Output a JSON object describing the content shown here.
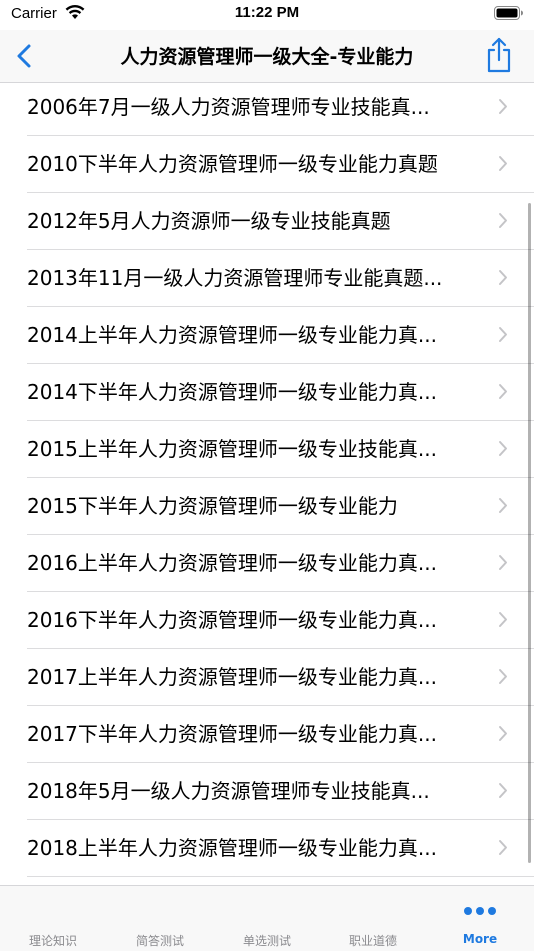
{
  "status_bar": {
    "carrier": "Carrier",
    "time": "11:22 PM",
    "wifi_icon": "wifi-icon",
    "battery_icon": "battery-icon"
  },
  "nav_bar": {
    "title": "人力资源管理师一级大全-专业能力",
    "back_icon": "chevron-left-icon",
    "share_icon": "share-icon",
    "accent_color": "#1f7ae0"
  },
  "list": {
    "items": [
      {
        "label": "2006年7月一级人力资源管理师专业技能真..."
      },
      {
        "label": "2010下半年人力资源管理师一级专业能力真题"
      },
      {
        "label": "2012年5月人力资源师一级专业技能真题"
      },
      {
        "label": "2013年11月一级人力资源管理师专业能真题..."
      },
      {
        "label": "2014上半年人力资源管理师一级专业能力真..."
      },
      {
        "label": "2014下半年人力资源管理师一级专业能力真..."
      },
      {
        "label": "2015上半年人力资源管理师一级专业技能真..."
      },
      {
        "label": "2015下半年人力资源管理师一级专业能力"
      },
      {
        "label": "2016上半年人力资源管理师一级专业能力真..."
      },
      {
        "label": "2016下半年人力资源管理师一级专业能力真..."
      },
      {
        "label": "2017上半年人力资源管理师一级专业能力真..."
      },
      {
        "label": "2017下半年人力资源管理师一级专业能力真..."
      },
      {
        "label": "2018年5月一级人力资源管理师专业技能真..."
      },
      {
        "label": "2018上半年人力资源管理师一级专业能力真..."
      }
    ],
    "chevron_icon": "chevron-right-icon"
  },
  "tab_bar": {
    "tabs": [
      {
        "label": "理论知识"
      },
      {
        "label": "简答测试"
      },
      {
        "label": "单选测试"
      },
      {
        "label": "职业道德"
      },
      {
        "label": "More",
        "icon": "more-dots-icon"
      }
    ],
    "active_color": "#1f7ae0",
    "inactive_color": "#8a8a8e"
  }
}
